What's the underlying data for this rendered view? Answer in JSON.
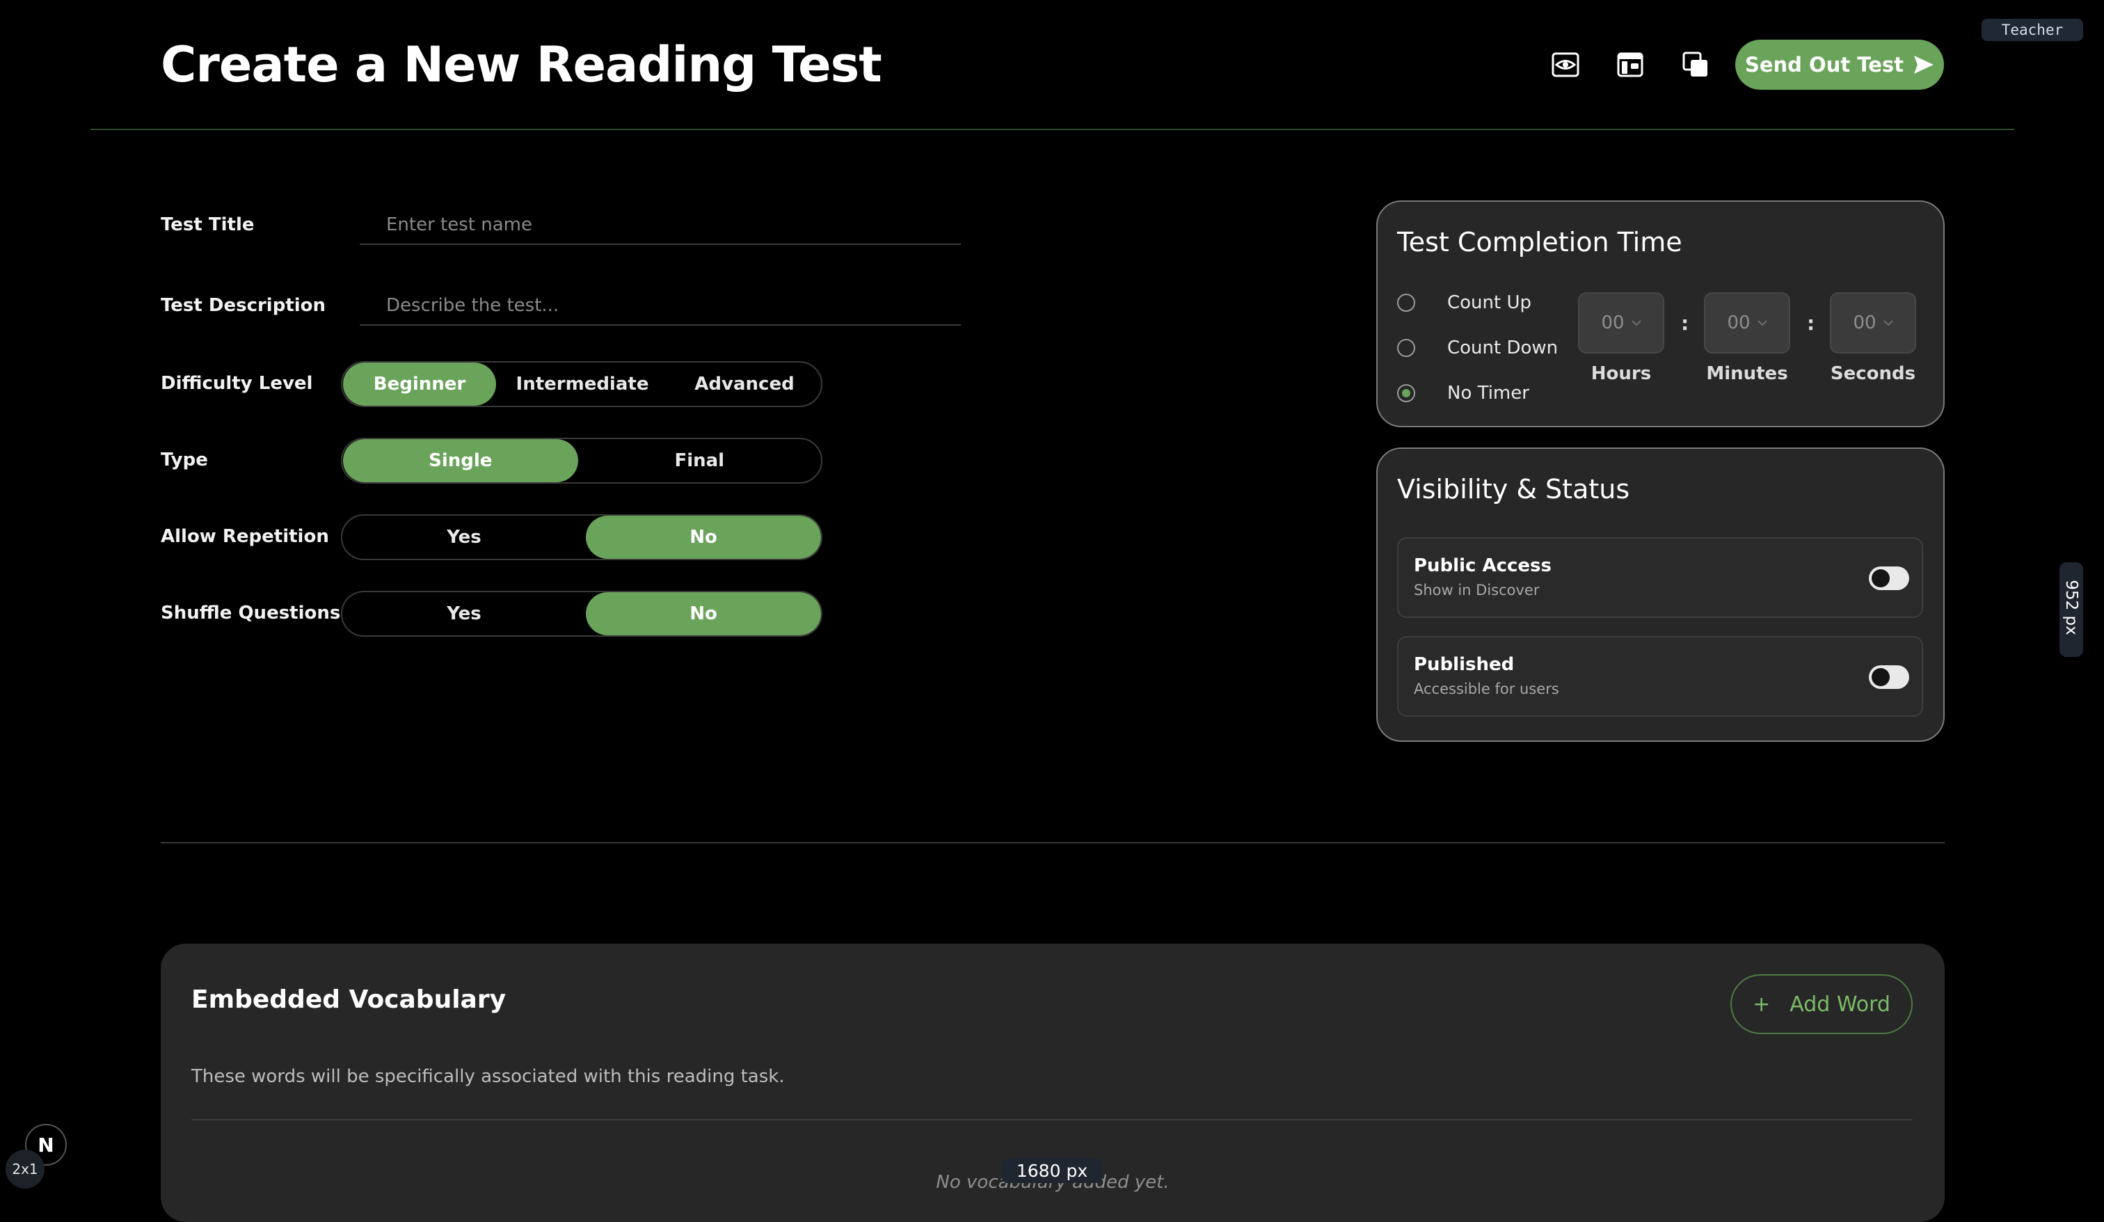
{
  "header": {
    "title": "Create a New Reading Test",
    "send_label": "Send Out Test",
    "role_badge": "Teacher",
    "icons": [
      "preview-eye-icon",
      "layout-icon",
      "copy-icon",
      "send-arrow-icon"
    ]
  },
  "form": {
    "title_label": "Test Title",
    "title_placeholder": "Enter test name",
    "desc_label": "Test Description",
    "desc_placeholder": "Describe the test...",
    "difficulty": {
      "label": "Difficulty Level",
      "options": [
        "Beginner",
        "Intermediate",
        "Advanced"
      ],
      "selected": "Beginner"
    },
    "type": {
      "label": "Type",
      "options": [
        "Single",
        "Final"
      ],
      "selected": "Single"
    },
    "repetition": {
      "label": "Allow Repetition",
      "options": [
        "Yes",
        "No"
      ],
      "selected": "No"
    },
    "shuffle": {
      "label": "Shuffle Questions",
      "options": [
        "Yes",
        "No"
      ],
      "selected": "No"
    }
  },
  "timer": {
    "title": "Test Completion Time",
    "options": [
      "Count Up",
      "Count Down",
      "No Timer"
    ],
    "selected": "No Timer",
    "hours": "00",
    "minutes": "00",
    "seconds": "00",
    "hours_label": "Hours",
    "minutes_label": "Minutes",
    "seconds_label": "Seconds",
    "separator": ":"
  },
  "visibility": {
    "title": "Visibility & Status",
    "public": {
      "label": "Public Access",
      "sub": "Show in Discover",
      "on": false
    },
    "published": {
      "label": "Published",
      "sub": "Accessible for users",
      "on": false
    }
  },
  "vocab": {
    "title": "Embedded Vocabulary",
    "add_label": "Add Word",
    "add_icon": "+",
    "description": "These words will be specifically associated with this reading task.",
    "empty": "No vocabulary added yet."
  },
  "overlay": {
    "width_readout": "1680 px",
    "height_readout": "952 px",
    "next_logo": "N",
    "zoom": "2x1"
  },
  "colors": {
    "accent": "#6aa35a",
    "background": "#000000",
    "card": "#272727"
  }
}
